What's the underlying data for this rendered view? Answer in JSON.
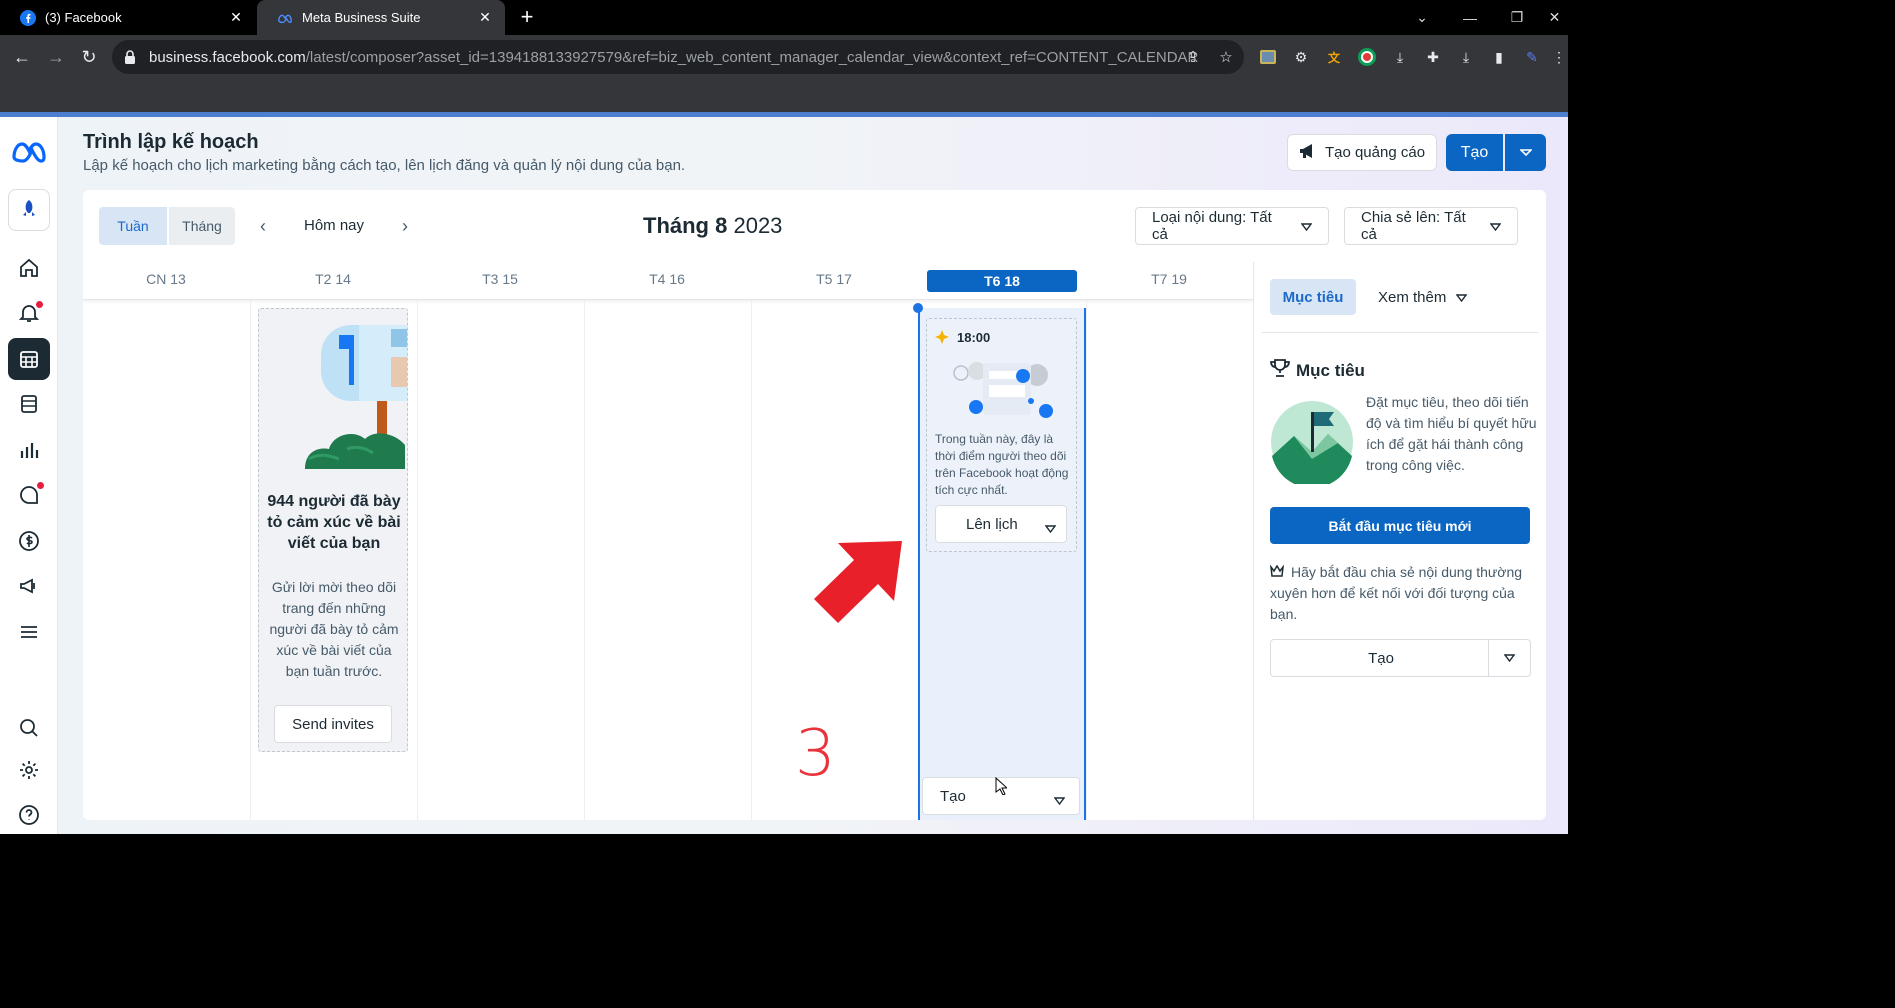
{
  "browser": {
    "tabs": [
      {
        "title": "(3) Facebook",
        "icon": "facebook-icon"
      },
      {
        "title": "Meta Business Suite",
        "icon": "meta-icon"
      }
    ],
    "url_host": "business.facebook.com",
    "url_path": "/latest/composer?asset_id=1394188133927579&ref=biz_web_content_manager_calendar_view&context_ref=CONTENT_CALENDAR"
  },
  "header": {
    "title": "Trình lập kế hoạch",
    "subtitle": "Lập kế hoạch cho lịch marketing bằng cách tạo, lên lịch đăng và quản lý nội dung của bạn.",
    "ad_button": "Tạo quảng cáo",
    "create_button": "Tạo"
  },
  "calendar": {
    "view_week": "Tuần",
    "view_month": "Tháng",
    "today": "Hôm nay",
    "month_name": "Tháng 8",
    "year": "2023",
    "filter_content": "Loại nội dung: Tất cả",
    "filter_share": "Chia sẻ lên: Tất cả",
    "days": [
      "CN 13",
      "T2 14",
      "T3 15",
      "T4 16",
      "T5 17",
      "T6 18",
      "T7 19"
    ],
    "current_day_index": 5
  },
  "promo": {
    "title": "944 người đã bày tỏ cảm xúc về bài viết của bạn",
    "body": "Gửi lời mời theo dõi trang đến những người đã bày tỏ cảm xúc về bài viết của bạn tuần trước.",
    "button": "Send invites"
  },
  "schedule_card": {
    "time": "18:00",
    "text": "Trong tuần này, đây là thời điểm người theo dõi trên Facebook hoạt động tích cực nhất.",
    "button": "Lên lịch",
    "column_create": "Tạo"
  },
  "right_panel": {
    "tab_goal": "Mục tiêu",
    "tab_more": "Xem thêm",
    "goal_title": "Mục tiêu",
    "goal_text": "Đặt mục tiêu, theo dõi tiến độ và tìm hiểu bí quyết hữu ích để gặt hái thành công trong công việc.",
    "goal_button": "Bắt đầu mục tiêu mới",
    "tip_text": "Hãy bắt đầu chia sẻ nội dung thường xuyên hơn để kết nối với đối tượng của bạn.",
    "create_button": "Tạo"
  },
  "annotation": {
    "number": "3",
    "color": "#e8333b"
  },
  "colors": {
    "brand_blue": "#0a66c2",
    "selected_col": "#e9f0fb"
  }
}
